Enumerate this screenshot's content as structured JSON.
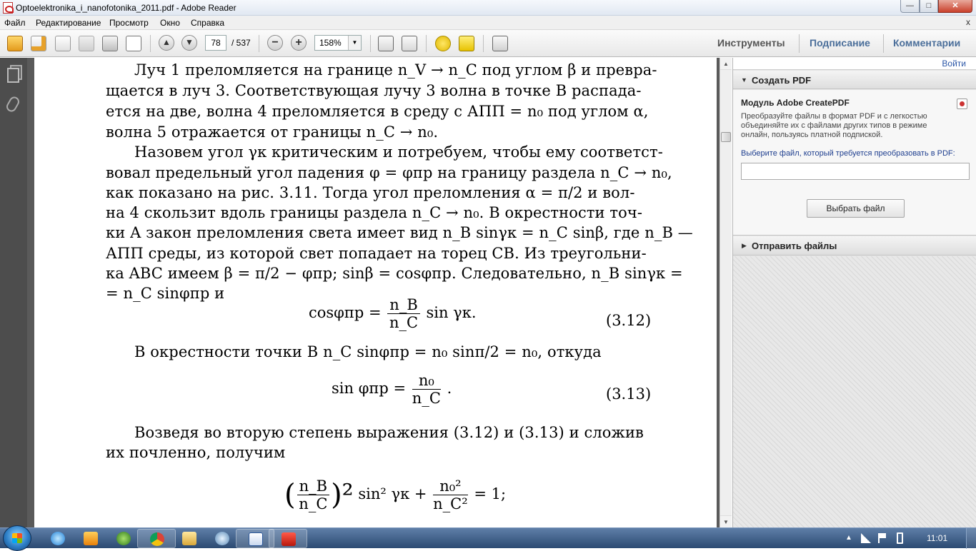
{
  "window": {
    "title": "Optoelektronika_i_nanofotonika_2011.pdf - Adobe Reader",
    "controls": {
      "minimize": "—",
      "maximize": "□",
      "close": "✕"
    }
  },
  "menu": {
    "items": [
      "Файл",
      "Редактирование",
      "Просмотр",
      "Окно",
      "Справка"
    ],
    "close": "x"
  },
  "toolbar": {
    "page_current": "78",
    "page_total": "/ 537",
    "zoom": "158%",
    "zoom_out": "−",
    "zoom_in": "+",
    "tabs": [
      "Инструменты",
      "Подписание",
      "Комментарии"
    ],
    "icons": [
      "open-icon",
      "create-pdf-icon",
      "edit-icon",
      "save-icon",
      "print-icon",
      "email-icon",
      "prev-page-icon",
      "next-page-icon",
      "fit-page-icon",
      "fit-width-icon",
      "comment-icon",
      "highlight-icon",
      "fullscreen-icon"
    ]
  },
  "document": {
    "lines": [
      "Луч 1 преломляется на границе n_V → n_C под углом β и превра-",
      "щается в луч 3. Соответствующая лучу 3 волна в точке B распада-",
      "ется на две, волна 4 преломляется в среду с АПП = n₀ под углом α,",
      "волна 5 отражается от границы n_C → n₀.",
      "Назовем угол γк критическим и потребуем, чтобы ему соответст-",
      "вовал предельный угол падения φ = φпр на границу раздела n_C → n₀,",
      "как показано на рис. 3.11. Тогда угол преломления α = π/2 и вол-",
      "на 4 скользит вдоль границы раздела n_C → n₀. В окрестности точ-",
      "ки A закон преломления света имеет вид n_B sinγк = n_C sinβ, где n_B —",
      "АПП среды, из которой свет попадает на торец CB. Из треугольни-",
      "ка ABC имеем β = π/2 − φпр; sinβ = cosφпр. Следовательно, n_B sinγк =",
      "= n_C sinφпр и"
    ],
    "eq_312": {
      "lhs": "cosφпр =",
      "num": "n_B",
      "den": "n_C",
      "rhs": "sin γк.",
      "number": "(3.12)"
    },
    "line_after_312": "В окрестности точки B n_C sinφпр = n₀ sinπ/2 = n₀, откуда",
    "eq_313": {
      "lhs": "sin φпр =",
      "num": "n₀",
      "den": "n_C",
      "rhs": ".",
      "number": "(3.13)"
    },
    "line_after_313_a": "Возведя во вторую степень выражения (3.12) и (3.13) и сложив",
    "line_after_313_b": "их почленно, получим",
    "eq_314": {
      "open": "(",
      "num": "n_B",
      "den": "n_C",
      "close": ")²",
      "mid": "sin² γк +",
      "num2": "n₀²",
      "den2": "n_C²",
      "rhs": "= 1;"
    }
  },
  "right_panel": {
    "signin": "Войти",
    "create_pdf": {
      "title": "Создать PDF",
      "module_title": "Модуль Adobe CreatePDF",
      "description": "Преобразуйте файлы в формат PDF и с легкостью объединяйте их с файлами других типов в режиме онлайн, пользуясь платной подпиской.",
      "choose_label": "Выберите файл, который требуется преобразовать в PDF:",
      "button": "Выбрать файл"
    },
    "send_files": {
      "title": "Отправить файлы"
    }
  },
  "taskbar": {
    "clock": "11:01",
    "apps": [
      "ie-icon",
      "media-player-icon",
      "winamp-icon",
      "chrome-icon",
      "explorer-icon",
      "app-icon",
      "word-icon",
      "adobe-reader-icon"
    ]
  }
}
